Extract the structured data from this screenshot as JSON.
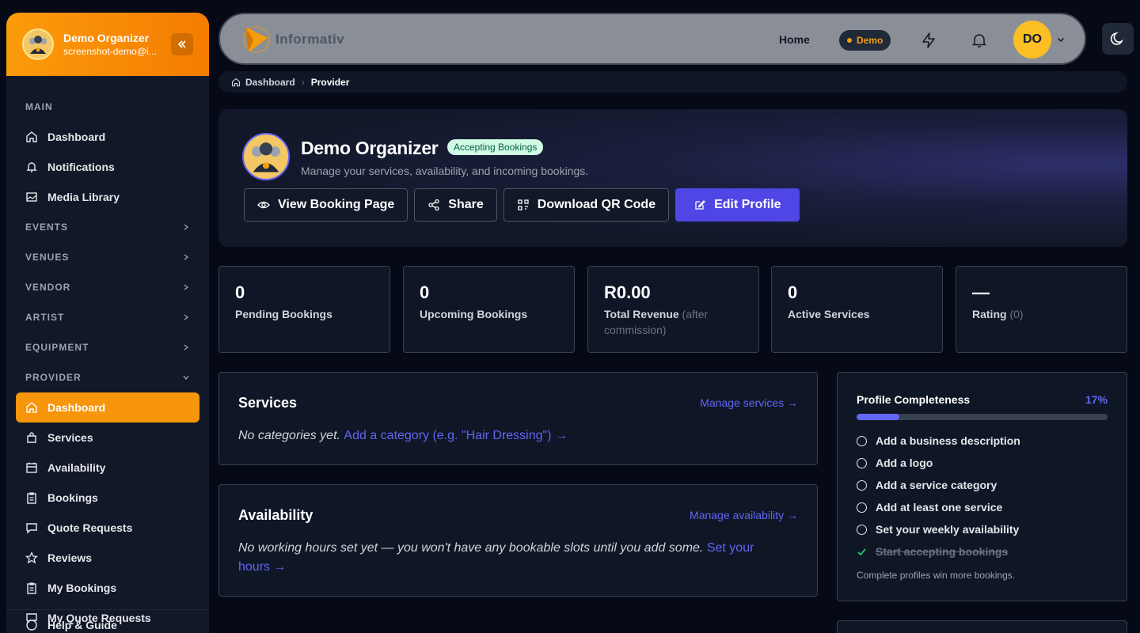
{
  "sidebar": {
    "user": {
      "name": "Demo Organizer",
      "email": "screenshot-demo@i..."
    },
    "sections": {
      "main": "MAIN",
      "events": "EVENTS",
      "venues": "VENUES",
      "vendor": "VENDOR",
      "artist": "ARTIST",
      "equipment": "EQUIPMENT",
      "provider": "PROVIDER"
    },
    "main_items": [
      {
        "label": "Dashboard",
        "icon": "home-icon"
      },
      {
        "label": "Notifications",
        "icon": "bell-icon"
      },
      {
        "label": "Media Library",
        "icon": "image-icon"
      }
    ],
    "provider_items": [
      {
        "label": "Dashboard",
        "icon": "home-icon",
        "active": true
      },
      {
        "label": "Services",
        "icon": "bag-icon"
      },
      {
        "label": "Availability",
        "icon": "calendar-icon"
      },
      {
        "label": "Bookings",
        "icon": "clipboard-icon"
      },
      {
        "label": "Quote Requests",
        "icon": "message-icon"
      },
      {
        "label": "Reviews",
        "icon": "star-icon"
      },
      {
        "label": "My Bookings",
        "icon": "clipboard-icon"
      },
      {
        "label": "My Quote Requests",
        "icon": "message-icon"
      }
    ],
    "footer_item": "Help & Guide"
  },
  "header": {
    "logo_text": "Informativ",
    "home": "Home",
    "demo_badge": "Demo",
    "avatar_initials": "DO"
  },
  "breadcrumb": {
    "root": "Dashboard",
    "current": "Provider"
  },
  "hero": {
    "title": "Demo Organizer",
    "status": "Accepting Bookings",
    "subtitle": "Manage your services, availability, and incoming bookings.",
    "actions": {
      "view": "View Booking Page",
      "share": "Share",
      "qr": "Download QR Code",
      "edit": "Edit Profile"
    }
  },
  "stats": [
    {
      "value": "0",
      "label": "Pending Bookings"
    },
    {
      "value": "0",
      "label": "Upcoming Bookings"
    },
    {
      "value": "R0.00",
      "label": "Total Revenue",
      "muted_1": "(after",
      "muted_2": "commission)"
    },
    {
      "value": "0",
      "label": "Active Services"
    },
    {
      "value": "—",
      "label": "Rating",
      "muted": "(0)"
    }
  ],
  "services": {
    "title": "Services",
    "link": "Manage services →",
    "empty": "No categories yet.",
    "cta": "Add a category (e.g. \"Hair Dressing\") →"
  },
  "availability": {
    "title": "Availability",
    "link": "Manage availability →",
    "empty": "No working hours set yet — you won't have any bookable slots until you add some.",
    "cta_1": "Set your",
    "cta_2": "hours →"
  },
  "profile_completeness": {
    "title": "Profile Completeness",
    "percent_label": "17%",
    "percent": 17,
    "items": [
      {
        "label": "Add a business description",
        "done": false
      },
      {
        "label": "Add a logo",
        "done": false
      },
      {
        "label": "Add a service category",
        "done": false
      },
      {
        "label": "Add at least one service",
        "done": false
      },
      {
        "label": "Set your weekly availability",
        "done": false
      },
      {
        "label": "Start accepting bookings",
        "done": true
      }
    ],
    "note": "Complete profiles win more bookings."
  },
  "colors": {
    "accent": "#4f46e5",
    "brand_orange": "#f59e0b",
    "success_bg": "#d1fae5"
  }
}
